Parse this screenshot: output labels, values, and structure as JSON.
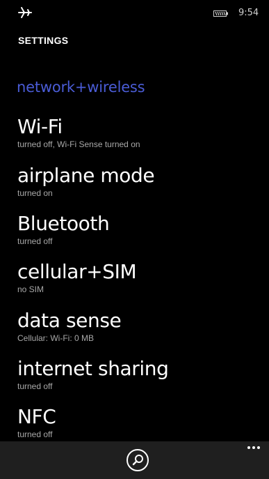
{
  "status_bar": {
    "time": "9:54",
    "icons": [
      "airplane-icon",
      "battery-icon"
    ]
  },
  "header": {
    "app_title": "SETTINGS",
    "page_title": "network+wireless"
  },
  "settings": {
    "items": [
      {
        "title": "Wi-Fi",
        "subtitle": "turned off, Wi-Fi Sense turned on"
      },
      {
        "title": "airplane mode",
        "subtitle": "turned on"
      },
      {
        "title": "Bluetooth",
        "subtitle": "turned off"
      },
      {
        "title": "cellular+SIM",
        "subtitle": "no SIM"
      },
      {
        "title": "data sense",
        "subtitle": "Cellular:  Wi-Fi: 0 MB"
      },
      {
        "title": "internet sharing",
        "subtitle": "turned off"
      },
      {
        "title": "NFC",
        "subtitle": "turned off"
      }
    ]
  },
  "app_bar": {
    "icons": [
      "search-icon",
      "more-icon"
    ]
  },
  "colors": {
    "background": "#000000",
    "accent": "#4a5cd6",
    "subtitle": "#a8a8a8",
    "app_bar": "#1f1f1f"
  }
}
